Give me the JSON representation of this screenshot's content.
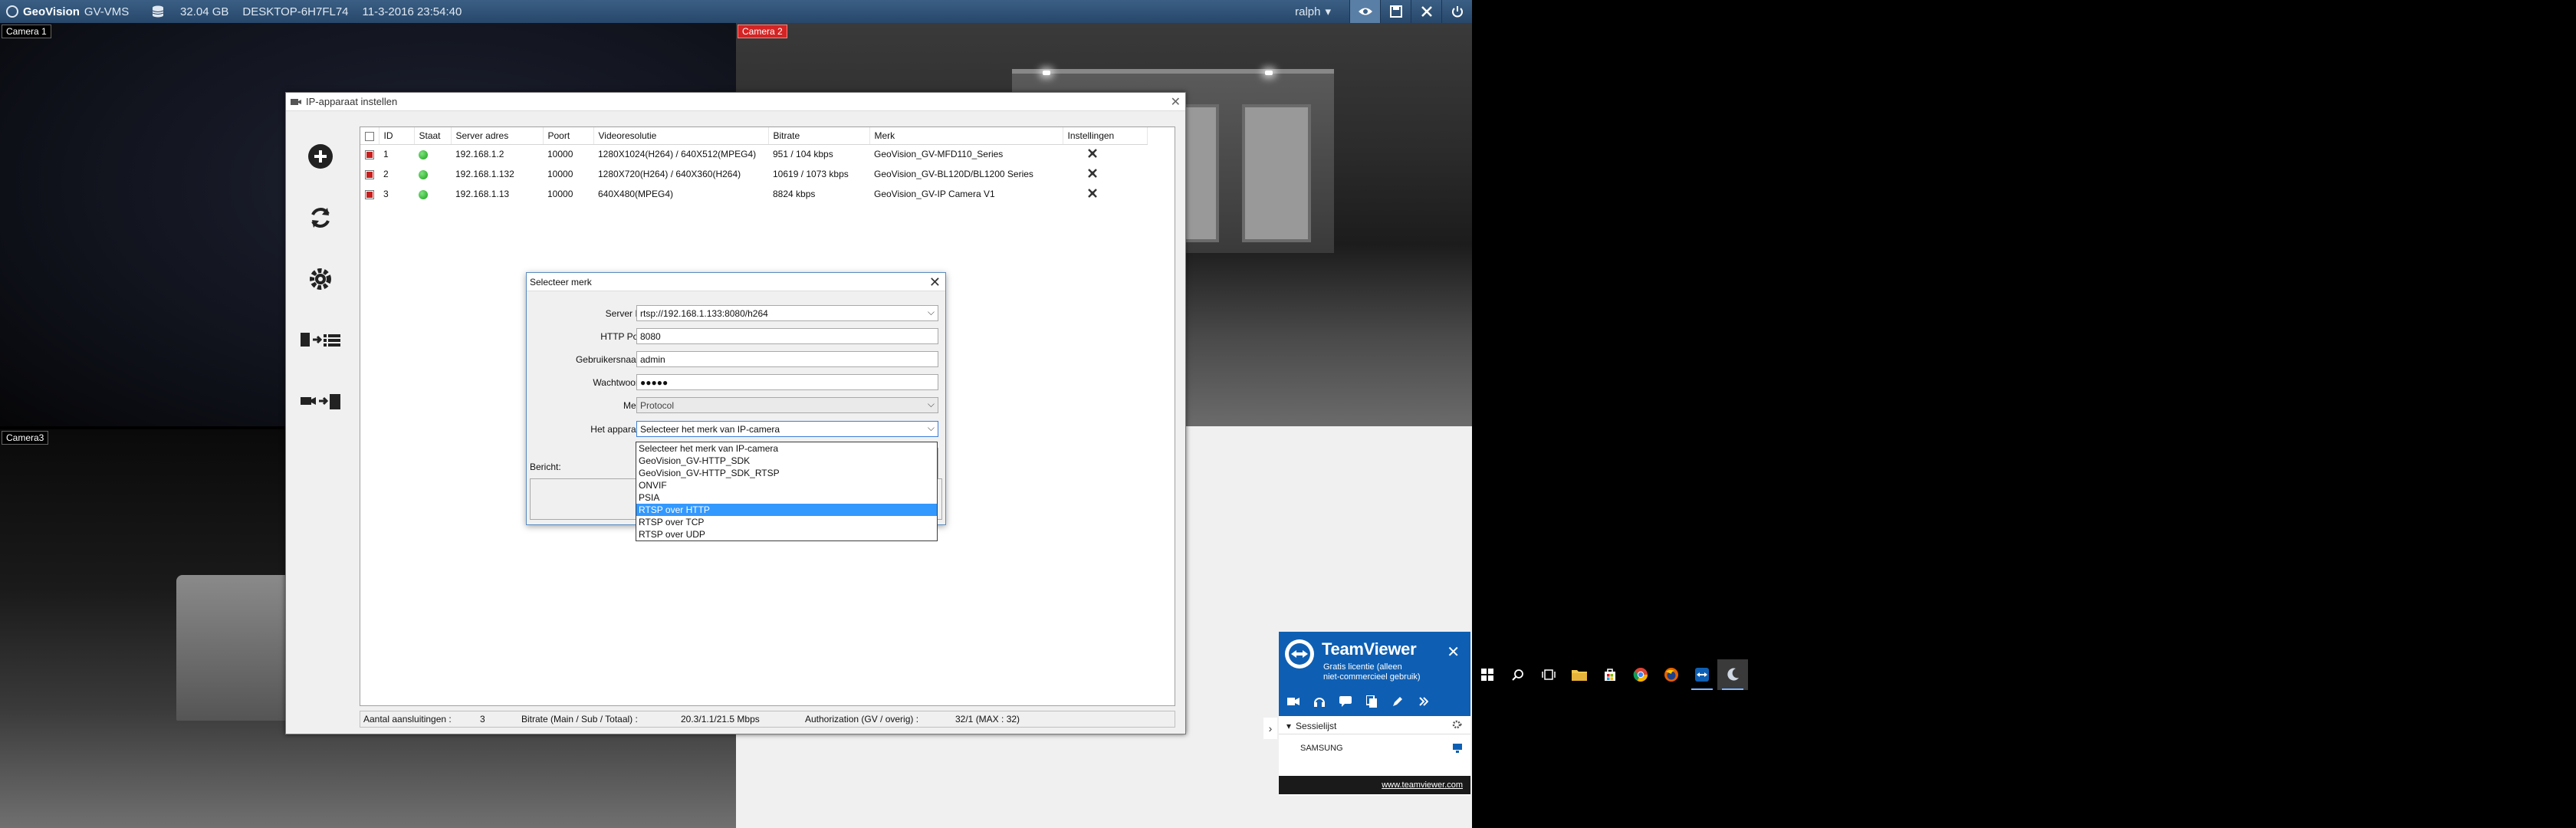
{
  "topbar": {
    "app_name": "GV-VMS",
    "brand": "GeoVision",
    "disk": "32.04 GB",
    "host": "DESKTOP-6H7FL74",
    "datetime": "11-3-2016 23:54:40",
    "user": "ralph"
  },
  "cameras": {
    "cam1": "Camera 1",
    "cam2": "Camera 2",
    "cam3": "Camera3"
  },
  "ip_window": {
    "title": "IP-apparaat instellen",
    "columns": [
      "ID",
      "Staat",
      "Server adres",
      "Poort",
      "Videoresolutie",
      "Bitrate",
      "Merk",
      "Instellingen"
    ],
    "rows": [
      {
        "id": "1",
        "address": "192.168.1.2",
        "port": "10000",
        "resolution": "1280X1024(H264) / 640X512(MPEG4)",
        "bitrate": "951 / 104 kbps",
        "brand": "GeoVision_GV-MFD110_Series"
      },
      {
        "id": "2",
        "address": "192.168.1.132",
        "port": "10000",
        "resolution": "1280X720(H264) / 640X360(H264)",
        "bitrate": "10619 / 1073 kbps",
        "brand": "GeoVision_GV-BL120D/BL1200 Series"
      },
      {
        "id": "3",
        "address": "192.168.1.13",
        "port": "10000",
        "resolution": "640X480(MPEG4)",
        "bitrate": "8824 kbps",
        "brand": "GeoVision_GV-IP Camera V1"
      }
    ],
    "status": {
      "connections_label": "Aantal aansluitingen :",
      "connections_value": "3",
      "bitrate_label": "Bitrate (Main / Sub / Totaal) :",
      "bitrate_value": "20.3/1.1/21.5 Mbps",
      "auth_label": "Authorization (GV / overig) :",
      "auth_value": "32/1 (MAX : 32)"
    }
  },
  "dialog": {
    "title": "Selecteer merk",
    "server_ip_label": "Server IP:",
    "server_ip_value": "rtsp://192.168.1.133:8080/h264",
    "http_port_label": "HTTP Port:",
    "http_port_value": "8080",
    "username_label": "Gebruikersnaam:",
    "username_value": "admin",
    "password_label": "Wachtwoord:",
    "password_value": "●●●●●",
    "brand_label": "Merk:",
    "brand_value": "Protocol",
    "device_label": "Het apparaat:",
    "device_value": "Selecteer het merk van IP-camera",
    "message_label": "Bericht:",
    "options": [
      "Selecteer het merk van IP-camera",
      "GeoVision_GV-HTTP_SDK",
      "GeoVision_GV-HTTP_SDK_RTSP",
      "ONVIF",
      "PSIA",
      "RTSP over HTTP",
      "RTSP over TCP",
      "RTSP over UDP"
    ],
    "selected_index": 5
  },
  "teamviewer": {
    "name": "TeamViewer",
    "license_line1": "Gratis licentie (alleen",
    "license_line2": "niet-commercieel gebruik)",
    "sessions_label": "Sessielijst",
    "session_item": "SAMSUNG",
    "footer_link": "www.teamviewer.com"
  },
  "colors": {
    "accent": "#0e5fb3",
    "selection": "#3399ff",
    "status_ok": "#19a019",
    "camera_label_active": "#d42424"
  }
}
